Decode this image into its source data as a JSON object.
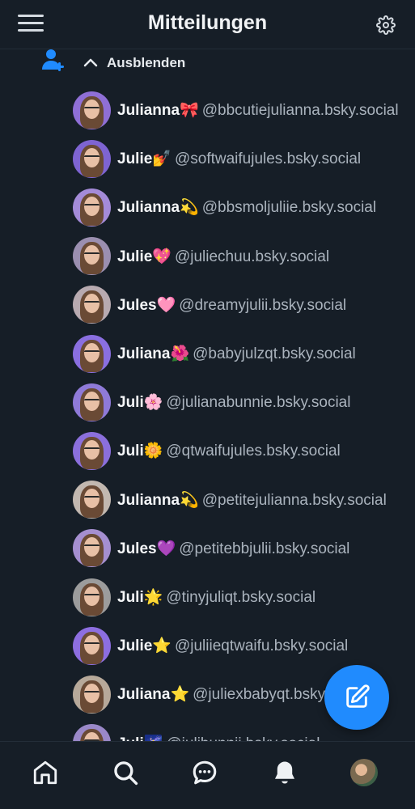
{
  "header": {
    "title": "Mitteilungen",
    "menu_icon": "hamburger-menu-icon",
    "settings_icon": "gear-icon"
  },
  "collapse": {
    "label": "Ausblenden",
    "icon": "chevron-up-icon",
    "follow_icon": "user-plus-icon"
  },
  "followers": [
    {
      "name": "Julianna🎀",
      "handle": "@bbcutiejulianna.bsky.social",
      "avatar_bg": "#8f6fd6"
    },
    {
      "name": "Julie💅",
      "handle": "@softwaifujules.bsky.social",
      "avatar_bg": "#7e64d2"
    },
    {
      "name": "Julianna💫",
      "handle": "@bbsmoljuliie.bsky.social",
      "avatar_bg": "#a48bd8"
    },
    {
      "name": "Julie💖",
      "handle": "@juliechuu.bsky.social",
      "avatar_bg": "#9b8fb0"
    },
    {
      "name": "Jules🩷",
      "handle": "@dreamyjulii.bsky.social",
      "avatar_bg": "#b8aab0"
    },
    {
      "name": "Juliana🌺",
      "handle": "@babyjulzqt.bsky.social",
      "avatar_bg": "#8a6fe0"
    },
    {
      "name": "Juli🌸",
      "handle": "@julianabunnie.bsky.social",
      "avatar_bg": "#8f7ad8"
    },
    {
      "name": "Juli🌼",
      "handle": "@qtwaifujules.bsky.social",
      "avatar_bg": "#8b6fdc"
    },
    {
      "name": "Julianna💫",
      "handle": "@petitejulianna.bsky.social",
      "avatar_bg": "#c2b8b0"
    },
    {
      "name": "Jules💜",
      "handle": "@petitebbjulii.bsky.social",
      "avatar_bg": "#a58fd0"
    },
    {
      "name": "Juli🌟",
      "handle": "@tinyjuliqt.bsky.social",
      "avatar_bg": "#9c9c9c"
    },
    {
      "name": "Julie⭐",
      "handle": "@juliieqtwaifu.bsky.social",
      "avatar_bg": "#8d6ee0"
    },
    {
      "name": "Juliana⭐",
      "handle": "@juliexbabyqt.bsky.social",
      "avatar_bg": "#b7a99a"
    },
    {
      "name": "Juli🌌",
      "handle": "@julibunnii.bsky.social",
      "avatar_bg": "#9a88c8"
    }
  ],
  "compose": {
    "icon": "compose-icon",
    "color": "#208bfe"
  },
  "nav": {
    "items": [
      {
        "icon": "home-icon"
      },
      {
        "icon": "search-icon"
      },
      {
        "icon": "chat-icon"
      },
      {
        "icon": "bell-icon",
        "active": true
      },
      {
        "icon": "profile-avatar"
      }
    ]
  },
  "colors": {
    "background": "#161e27",
    "accent": "#208bfe",
    "handle_text": "#aab3bd"
  }
}
